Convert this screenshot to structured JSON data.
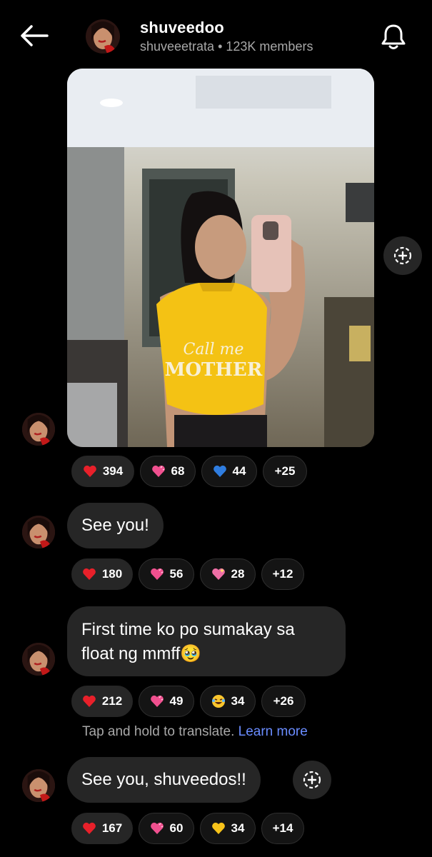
{
  "header": {
    "title": "shuveedoo",
    "channel": "shuveeetrata",
    "separator": " • ",
    "members": "123K members"
  },
  "photo": {
    "shirt_text_line1": "Call me",
    "shirt_text_line2": "MOTHER"
  },
  "messages": [
    {
      "type": "image",
      "reactions": [
        {
          "emoji": "heart-red",
          "count": "394"
        },
        {
          "emoji": "heart-pink",
          "count": "68"
        },
        {
          "emoji": "heart-blue",
          "count": "44"
        },
        {
          "emoji": "more",
          "count": "+25"
        }
      ]
    },
    {
      "type": "text",
      "text": "See you!",
      "reactions": [
        {
          "emoji": "heart-red",
          "count": "180"
        },
        {
          "emoji": "heart-pink",
          "count": "56"
        },
        {
          "emoji": "heart-sparkle",
          "count": "28"
        },
        {
          "emoji": "more",
          "count": "+12"
        }
      ]
    },
    {
      "type": "text",
      "text": "First time ko po sumakay sa float ng mmff🥹",
      "reactions": [
        {
          "emoji": "heart-red",
          "count": "212"
        },
        {
          "emoji": "heart-pink",
          "count": "49"
        },
        {
          "emoji": "laugh-cry",
          "count": "34"
        },
        {
          "emoji": "more",
          "count": "+26"
        }
      ],
      "translate_hint": "Tap and hold to translate.",
      "learn_more": "Learn more"
    },
    {
      "type": "text",
      "text": "See you, shuveedos!!",
      "reactions": [
        {
          "emoji": "heart-red",
          "count": "167"
        },
        {
          "emoji": "heart-pink",
          "count": "60"
        },
        {
          "emoji": "heart-yellow",
          "count": "34"
        },
        {
          "emoji": "more",
          "count": "+14"
        }
      ]
    }
  ],
  "colors": {
    "background": "#000000",
    "bubble": "#262626",
    "link": "#6a8cff",
    "muted": "#a8a8a8"
  }
}
